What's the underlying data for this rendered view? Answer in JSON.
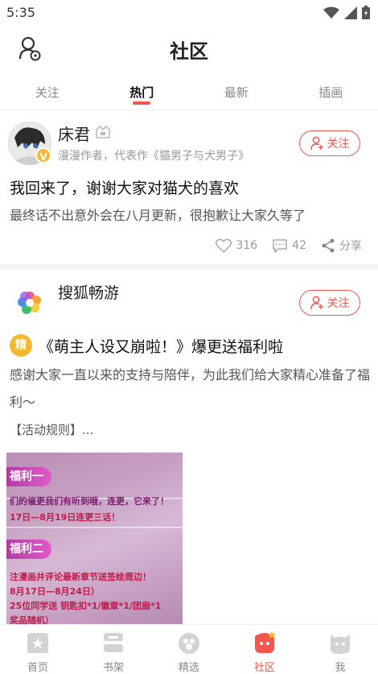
{
  "status_bar": {
    "time": "5:35"
  },
  "header": {
    "title": "社区"
  },
  "tabs": [
    {
      "label": "关注",
      "active": false
    },
    {
      "label": "热门",
      "active": true
    },
    {
      "label": "最新",
      "active": false
    },
    {
      "label": "插画",
      "active": false
    }
  ],
  "posts": [
    {
      "author": "床君",
      "author_desc": "漫漫作者，代表作《猫男子与犬男子》",
      "verified_badge": "V",
      "follow_label": "关注",
      "title": "我回来了，谢谢大家对猫犬的喜欢",
      "body": "最终话不出意外会在八月更新，很抱歉让大家久等了",
      "likes": "316",
      "comments": "42",
      "share_label": "分享"
    },
    {
      "author": "搜狐畅游",
      "follow_label": "关注",
      "badge": "精",
      "title": "《萌主人设又崩啦！》爆更送福利啦",
      "body": "感谢大家一直以来的支持与陪伴，为此我们给大家精心准备了福利～",
      "more": "【活动规则】...",
      "image": {
        "tag1": "福利一",
        "line1": "们的催更我们有听到哦，连更，它来了！",
        "line2": "17日—8月19日连更三话！",
        "tag2": "福利二",
        "line3": "注漫画并评论最新章节送签绘周边！",
        "line4": "8月17日—8月24日）",
        "line5": "25位同学送 钥匙扣*1/徽章*1/团扇*1",
        "line6": "奖品随机）"
      }
    }
  ],
  "bottom_nav": [
    {
      "label": "首页",
      "icon": "home-icon",
      "active": false
    },
    {
      "label": "书架",
      "icon": "bookshelf-icon",
      "active": false
    },
    {
      "label": "精选",
      "icon": "featured-icon",
      "active": false
    },
    {
      "label": "社区",
      "icon": "community-icon",
      "active": true
    },
    {
      "label": "我",
      "icon": "profile-icon",
      "active": false
    }
  ],
  "colors": {
    "accent": "#f2564c",
    "gold": "#f5b82e",
    "muted": "#999999"
  }
}
